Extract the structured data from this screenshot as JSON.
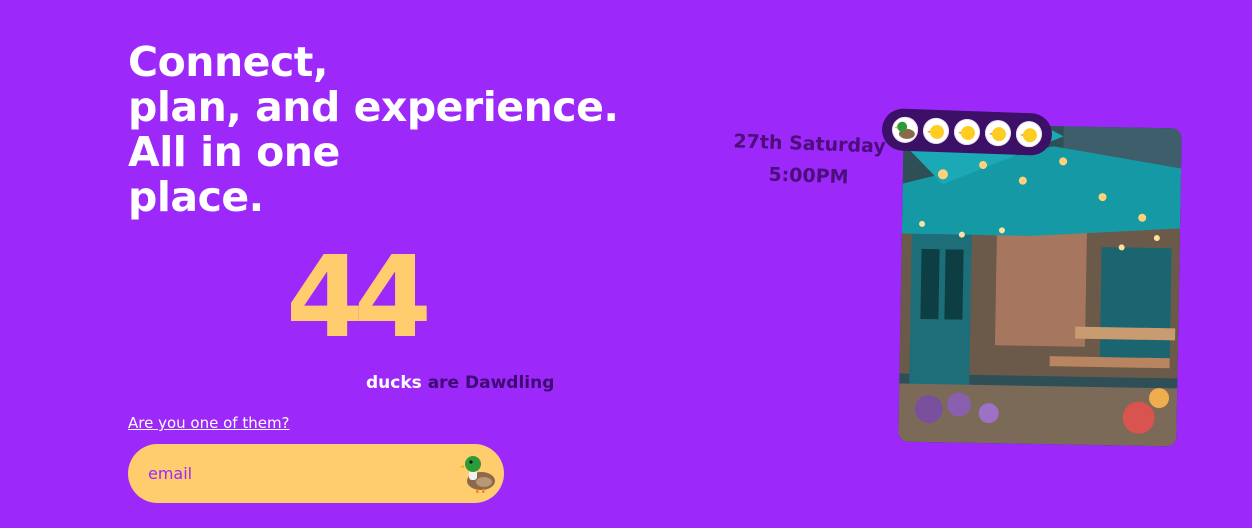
{
  "hero": {
    "headline_lines": [
      "Connect,",
      "plan, and experience.",
      "All in one",
      "place."
    ]
  },
  "stats": {
    "count": "44",
    "caption_word1": "ducks",
    "caption_rest": "are Dawdling"
  },
  "signup": {
    "question_link": "Are you one of them?",
    "email_placeholder": "email",
    "submit_icon": "mallard-duck-icon"
  },
  "event": {
    "date": "27th Saturday",
    "time": "5:00PM",
    "photo": "restaurant-patio-photo",
    "attendee_avatars": [
      "mallard-duck-icon",
      "baby-chick-icon",
      "baby-chick-icon",
      "baby-chick-icon",
      "baby-chick-icon"
    ]
  },
  "colors": {
    "background": "#9d28fa",
    "accent_yellow": "#ffcd6e",
    "dark_purple": "#3f0a73",
    "text_white": "#ffffff"
  }
}
